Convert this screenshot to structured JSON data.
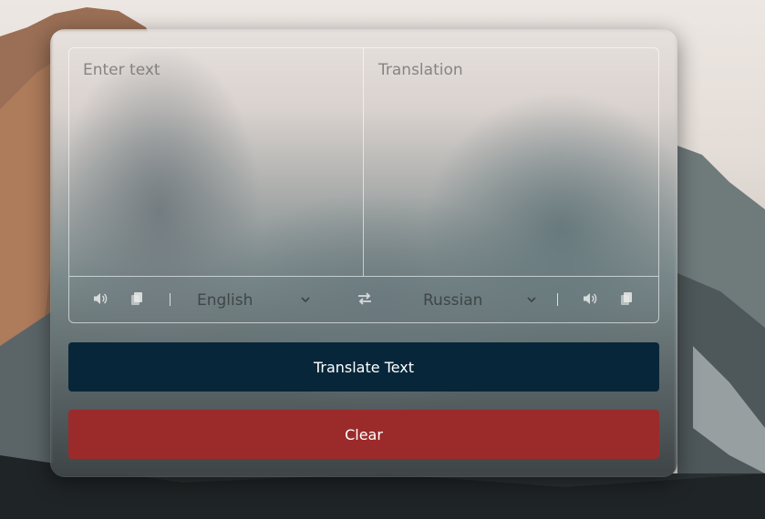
{
  "translator": {
    "source_placeholder": "Enter text",
    "target_placeholder": "Translation",
    "source_language": "English",
    "target_language": "Russian",
    "translate_button_label": "Translate Text",
    "clear_button_label": "Clear"
  },
  "icons": {
    "source_speaker": "volume-icon",
    "source_copy": "copy-icon",
    "swap": "exchange-icon",
    "target_speaker": "volume-icon",
    "target_copy": "copy-icon"
  },
  "colors": {
    "translate_button_bg": "#07263a",
    "clear_button_bg": "#9b2b2b"
  }
}
